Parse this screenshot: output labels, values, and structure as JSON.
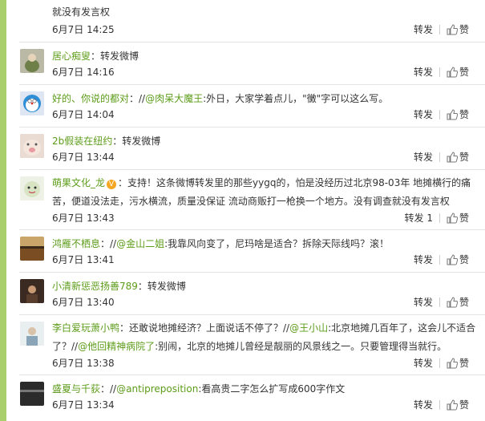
{
  "actions": {
    "forward": "转发",
    "forward_with_count": "转发 1",
    "like": "赞"
  },
  "comments": [
    {
      "text": "就没有发言权",
      "time": "6月7日 14:25"
    },
    {
      "user": "居心痴叟",
      "text": "：转发微博",
      "time": "6月7日 14:16"
    },
    {
      "user": "好的、你说的都对",
      "pre": "：//",
      "mention": "@肉呆大魔王",
      "text": ":外日，大家学着点儿，\"黴\"字可以这么写。",
      "time": "6月7日 14:04"
    },
    {
      "user": "2b假装在纽约",
      "text": "：转发微博",
      "time": "6月7日 13:44"
    },
    {
      "user": "萌果文化_龙",
      "badge": "V",
      "text": "：支持！这条微博转发里的那些yygq的，怕是没经历过北京98-03年 地摊横行的痛苦，便道没法走，污水横流，质量没保证 流动商贩打一枪换一个地方。没有调查就没有发言权",
      "time": "6月7日 13:43"
    },
    {
      "user": "鸿雁不栖息",
      "pre": "：//",
      "mention": "@金山二姐",
      "text": ":我靠风向变了，尼玛啥是适合？拆除天际线吗？滚！",
      "time": "6月7日 13:41"
    },
    {
      "user": "小清新惩恶扬善789",
      "text": "：转发微博",
      "time": "6月7日 13:40"
    },
    {
      "user": "李白爱玩萧小鸭",
      "pre": "：还敢说地摊经济？上面说话不停了？//",
      "mention": "@王小山",
      "mid": ":北京地摊几百年了，这会儿不适合了？//",
      "mention2": "@他回精神病院了",
      "text": ":别闹，北京的地摊儿曾经是靓丽的风景线之一。只要管理得当就行。",
      "time": "6月7日 13:38"
    },
    {
      "user": "盛夏与千荻",
      "pre": "：//",
      "mention": "@antipreposition",
      "text": ":看高贵二字怎么扩写成600字作文",
      "time": "6月7日 13:34"
    }
  ]
}
